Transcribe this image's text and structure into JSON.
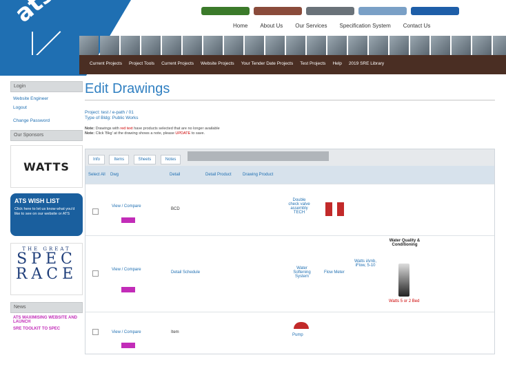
{
  "header": {
    "top_buttons": [
      {
        "label": "",
        "color": "#3b7a2a"
      },
      {
        "label": "",
        "color": "#8a4b3b"
      },
      {
        "label": "",
        "color": "#6a7279"
      },
      {
        "label": "",
        "color": "#7aa0c6"
      },
      {
        "label": "",
        "color": "#1e5ea8"
      }
    ],
    "main_nav": [
      "Home",
      "About Us",
      "Our Services",
      "Specification System",
      "Contact Us"
    ],
    "sub_nav": [
      "Current Projects",
      "Project Tools",
      "Current Projects",
      "Website Projects",
      "Your Tender Date Projects",
      "Test Projects",
      "Help",
      "2019 SRE Library"
    ]
  },
  "sidebar": {
    "login_heading": "Login",
    "login_links": [
      "Website Engineer",
      "Logout",
      "Change Password"
    ],
    "sponsors_heading": "Our Sponsors",
    "sponsor_logo": "WATTS",
    "wishlist_title": "ATS WISH LIST",
    "wishlist_text": "Click here to let us know what you'd like to see on our website or ATS",
    "spec_race_top": "THE GREAT",
    "spec_race_mid": "SPEC",
    "spec_race_bottom": "RACE",
    "news_heading": "News",
    "news_links": [
      "ATS MAXIMISING WEBSITE AND LAUNCH",
      "SRE TOOLKIT TO SPEC"
    ]
  },
  "main": {
    "title": "Edit Drawings",
    "project_line": "Project: test / e-path / 01",
    "type_line": "Type of Bldg: Public Works",
    "note1_prefix": "Note:",
    "note1_text": "Drawings with ",
    "note1_red": "red text",
    "note1_suffix": " have products selected that are no longer available",
    "note2_prefix": "Note:",
    "note2_text": "Click 'Bkg' at the drawing shows a note, please ",
    "note2_red": "UPDATE",
    "note2_suffix": " to save.",
    "tabs": [
      "Info",
      "Items",
      "Sheets",
      "Notes"
    ],
    "columns": [
      "Select All",
      "Dwg",
      "Detail",
      "Detail Product",
      "Drawing Product"
    ],
    "rows": [
      {
        "dwg_link": "View / Compare",
        "detail": "BCD",
        "product_text": "Double check valve assembly TECH"
      },
      {
        "dwg_link": "View / Compare",
        "detail": "Detail Schedule",
        "product_col1": "Water Softening System",
        "product_col2": "Flow Meter",
        "product_col3": "Watts iAmb, iFlow, 5-10",
        "side_title": "Water Quality & Conditioning",
        "side_caption": "Watts 5 or 2 Bed"
      },
      {
        "dwg_link": "View / Compare",
        "detail": "Item",
        "product_text": "Pump"
      }
    ]
  }
}
